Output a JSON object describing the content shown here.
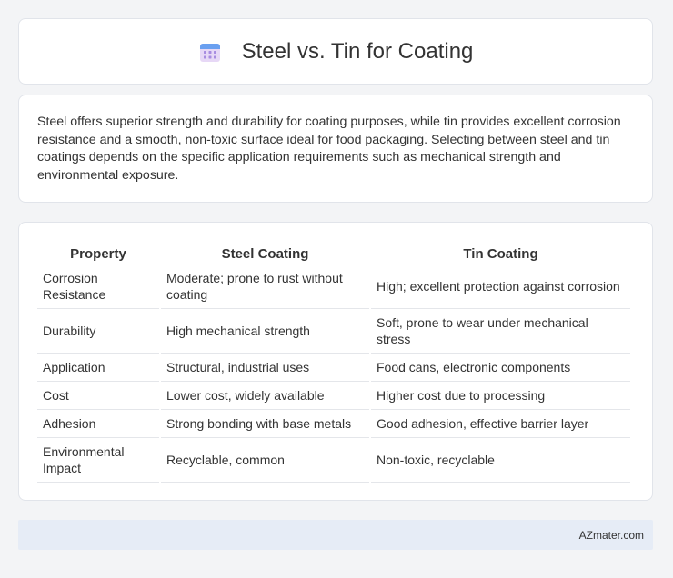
{
  "header": {
    "title": "Steel vs. Tin for Coating",
    "icon": "calendar-icon"
  },
  "intro": "Steel offers superior strength and durability for coating purposes, while tin provides excellent corrosion resistance and a smooth, non-toxic surface ideal for food packaging. Selecting between steel and tin coatings depends on the specific application requirements such as mechanical strength and environmental exposure.",
  "table": {
    "headers": [
      "Property",
      "Steel Coating",
      "Tin Coating"
    ],
    "rows": [
      [
        "Corrosion Resistance",
        "Moderate; prone to rust without coating",
        "High; excellent protection against corrosion"
      ],
      [
        "Durability",
        "High mechanical strength",
        "Soft, prone to wear under mechanical stress"
      ],
      [
        "Application",
        "Structural, industrial uses",
        "Food cans, electronic components"
      ],
      [
        "Cost",
        "Lower cost, widely available",
        "Higher cost due to processing"
      ],
      [
        "Adhesion",
        "Strong bonding with base metals",
        "Good adhesion, effective barrier layer"
      ],
      [
        "Environmental Impact",
        "Recyclable, common",
        "Non-toxic, recyclable"
      ]
    ]
  },
  "footer": {
    "brand": "AZmater.com"
  },
  "colors": {
    "icon_top": "#6aa0f0",
    "icon_body": "#e7d8f6",
    "icon_dots": "#a88ce0"
  }
}
